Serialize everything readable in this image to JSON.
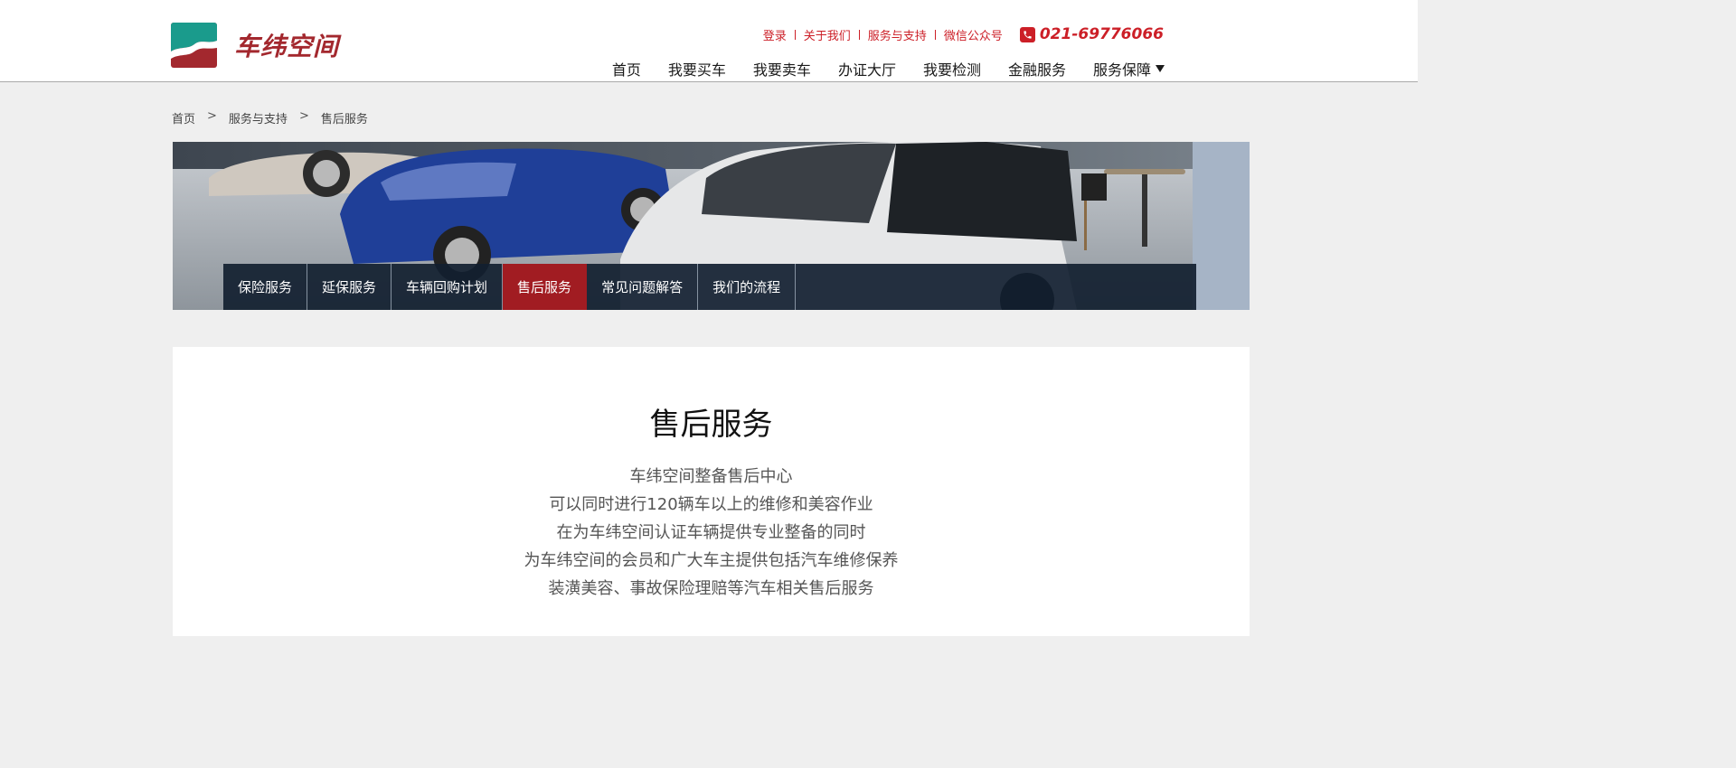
{
  "brand": {
    "name": "车纬空间"
  },
  "top_links": [
    "登录",
    "关于我们",
    "服务与支持",
    "微信公众号"
  ],
  "phone": "021-69776066",
  "main_nav": [
    "首页",
    "我要买车",
    "我要卖车",
    "办证大厅",
    "我要检测",
    "金融服务",
    "服务保障"
  ],
  "breadcrumb": [
    "首页",
    ">",
    "服务与支持",
    ">",
    "售后服务"
  ],
  "sub_nav": [
    "保险服务",
    "延保服务",
    "车辆回购计划",
    "售后服务",
    "常见问题解答",
    "我们的流程"
  ],
  "sub_nav_active": "售后服务",
  "content": {
    "title": "售后服务",
    "lines": [
      "车纬空间整备售后中心",
      "可以同时进行120辆车以上的维修和美容作业",
      "在为车纬空间认证车辆提供专业整备的同时",
      "为车纬空间的会员和广大车主提供包括汽车维修保养",
      "装潢美容、事故保险理赔等汽车相关售后服务"
    ]
  },
  "colors": {
    "brand_red": "#cc1f27",
    "logo_red": "#a3282e",
    "logo_teal": "#1a9b8c",
    "subnav_bg": "#122030",
    "active_tab": "#a11c22"
  }
}
